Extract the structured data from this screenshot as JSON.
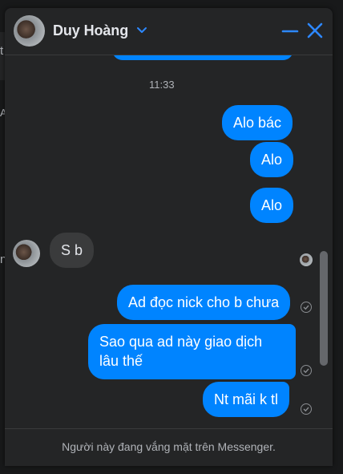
{
  "contact": {
    "name": "Duy Hoàng"
  },
  "conversation": {
    "timestamp": "11:33",
    "messages": [
      {
        "from": "me",
        "text": "Alo bác"
      },
      {
        "from": "me",
        "text": "Alo"
      },
      {
        "from": "me",
        "text": "Alo"
      },
      {
        "from": "them",
        "text": "S b"
      },
      {
        "from": "me",
        "text": "Ad đọc nick cho b chưa"
      },
      {
        "from": "me",
        "text_line1": "Sao qua ad này giao dịch",
        "text_line2": "lâu thế"
      },
      {
        "from": "me",
        "text": "Nt mãi k tl"
      }
    ]
  },
  "footer": {
    "status": "Người này đang vắng mặt trên Messenger."
  },
  "background": {
    "fragments": [
      "t",
      "Al",
      "n"
    ]
  },
  "colors": {
    "accent": "#0084ff",
    "panel": "#242526",
    "incoming": "#3a3b3c"
  },
  "icons": [
    "chevron-down-icon",
    "minimize-icon",
    "close-icon",
    "sent-check-icon"
  ]
}
